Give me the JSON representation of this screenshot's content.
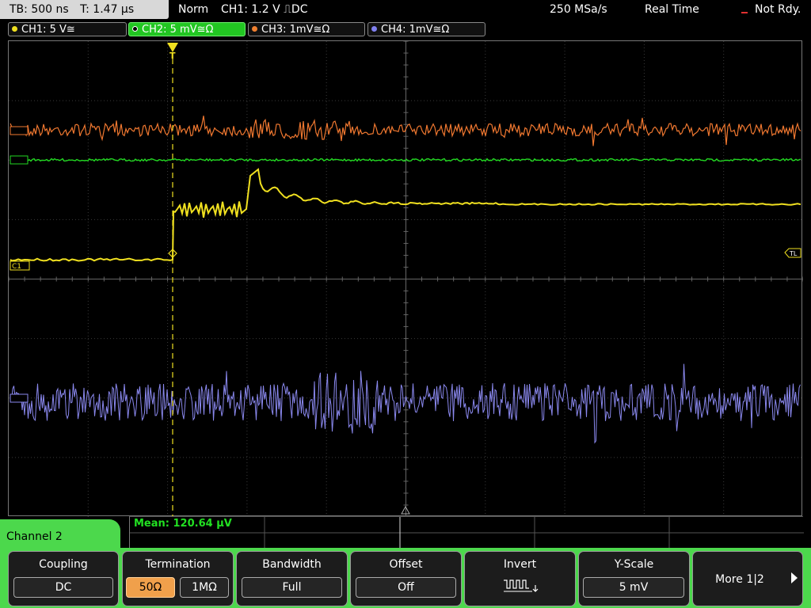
{
  "topbar": {
    "timebase": "TB: 500 ns",
    "trigger_time": "T: 1.47 µs",
    "trigger_mode": "Norm",
    "trigger_info": "CH1: 1.2 V ⎍DC",
    "sample_rate": "250 MSa/s",
    "acq_mode": "Real Time",
    "status": "Not Rdy."
  },
  "channels": [
    {
      "label": "CH1: 5 V≅",
      "color": "#f0e020"
    },
    {
      "label": "CH2: 5 mV≅Ω",
      "color": "#22c622"
    },
    {
      "label": "CH3: 1mV≅Ω",
      "color": "#f08030"
    },
    {
      "label": "CH4: 1mV≅Ω",
      "color": "#8080f0"
    }
  ],
  "plot": {
    "markers": {
      "ch1": "C1",
      "trigger_level": "TL",
      "trigger_time": "T"
    },
    "trace_colors": {
      "ch1": "#f0e020",
      "ch2": "#22d822",
      "ch3": "#f07830",
      "ch4": "#8a88ee"
    }
  },
  "measurement": {
    "mean": "Mean: 120.64 µV"
  },
  "menu": {
    "title": "Channel 2"
  },
  "softkeys": {
    "coupling": {
      "title": "Coupling",
      "value": "DC"
    },
    "termination": {
      "title": "Termination",
      "opt1": "50Ω",
      "opt2": "1MΩ",
      "selected": "50Ω"
    },
    "bandwidth": {
      "title": "Bandwidth",
      "value": "Full"
    },
    "offset": {
      "title": "Offset",
      "value": "Off"
    },
    "invert": {
      "title": "Invert",
      "icon": "invert-waveform-icon"
    },
    "yscale": {
      "title": "Y-Scale",
      "value": "5 mV"
    },
    "more": {
      "label": "More 1|2"
    }
  }
}
